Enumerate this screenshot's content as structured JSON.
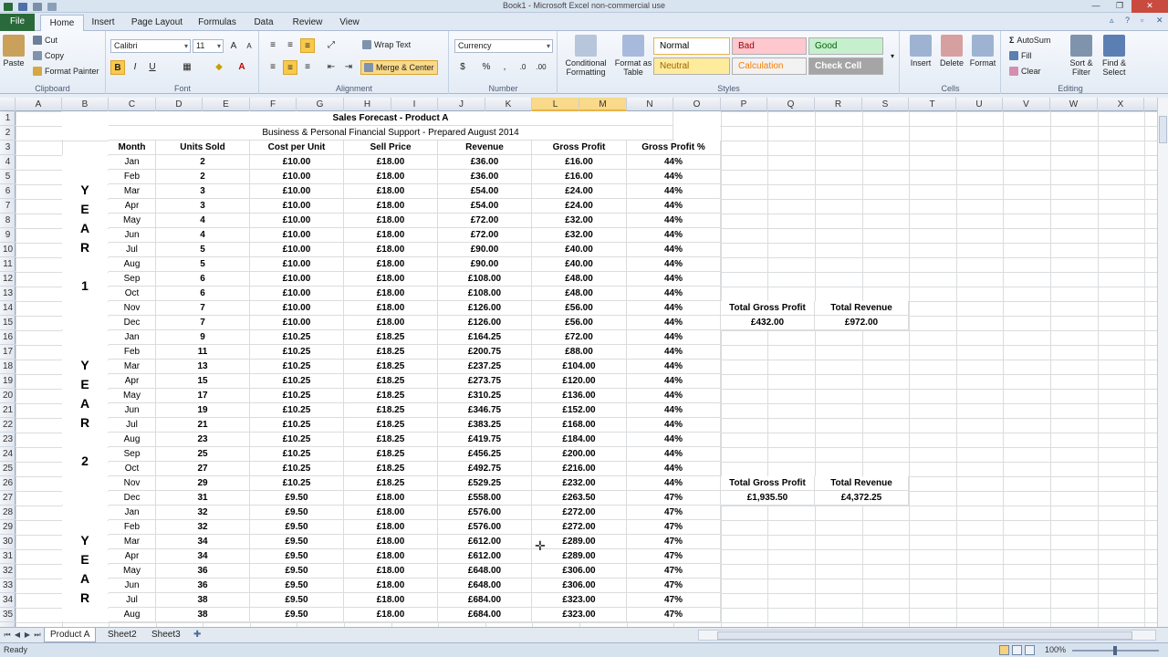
{
  "window": {
    "title": "Book1 - Microsoft Excel non-commercial use",
    "controls": [
      "—",
      "❐",
      "✕"
    ]
  },
  "ribbon_tabs": [
    "File",
    "Home",
    "Insert",
    "Page Layout",
    "Formulas",
    "Data",
    "Review",
    "View"
  ],
  "ribbon": {
    "clipboard": {
      "paste": "Paste",
      "cut": "Cut",
      "copy": "Copy",
      "format_painter": "Format Painter",
      "label": "Clipboard"
    },
    "font": {
      "name": "Calibri",
      "size": "11",
      "bold": "B",
      "italic": "I",
      "underline": "U",
      "label": "Font"
    },
    "alignment": {
      "wrap_text": "Wrap Text",
      "merge_center": "Merge & Center",
      "label": "Alignment"
    },
    "number": {
      "format": "Currency",
      "percent": "%",
      "comma": ",",
      "label": "Number"
    },
    "styles": {
      "conditional_formatting": "Conditional Formatting",
      "format_as_table": "Format as Table",
      "normal": "Normal",
      "bad": "Bad",
      "good": "Good",
      "neutral": "Neutral",
      "calculation": "Calculation",
      "check_cell": "Check Cell",
      "label": "Styles"
    },
    "cells": {
      "insert": "Insert",
      "delete": "Delete",
      "format": "Format",
      "label": "Cells"
    },
    "editing": {
      "autosum": "AutoSum",
      "fill": "Fill",
      "clear": "Clear",
      "sort_filter": "Sort & Filter",
      "find_select": "Find & Select",
      "label": "Editing"
    }
  },
  "columns": [
    "A",
    "B",
    "C",
    "D",
    "E",
    "F",
    "G",
    "H",
    "I",
    "J",
    "K",
    "L",
    "M",
    "N",
    "O",
    "P",
    "Q",
    "R",
    "S",
    "T",
    "U",
    "V",
    "W",
    "X"
  ],
  "selected_column": [
    "L",
    "M"
  ],
  "rows": [
    "1",
    "2",
    "3",
    "4",
    "5",
    "6",
    "7",
    "8",
    "9",
    "10",
    "11",
    "12",
    "13",
    "14",
    "15",
    "16",
    "17",
    "18",
    "19",
    "20",
    "21",
    "22",
    "23",
    "24",
    "25",
    "26",
    "27",
    "28",
    "29",
    "30",
    "31",
    "32",
    "33",
    "34",
    "35"
  ],
  "sheet": {
    "title": "Sales Forecast - Product A",
    "subtitle": "Business & Personal Financial Support - Prepared August 2014",
    "headers": [
      "Month",
      "Units Sold",
      "Cost per Unit",
      "Sell Price",
      "Revenue",
      "Gross Profit",
      "Gross Profit %"
    ],
    "year_labels": [
      [
        "Y",
        "E",
        "A",
        "R",
        "",
        "1"
      ],
      [
        "Y",
        "E",
        "A",
        "R",
        "",
        "2"
      ],
      [
        "Y",
        "E",
        "A",
        "R"
      ]
    ],
    "data": [
      [
        "Jan",
        "2",
        "£10.00",
        "£18.00",
        "£36.00",
        "£16.00",
        "44%"
      ],
      [
        "Feb",
        "2",
        "£10.00",
        "£18.00",
        "£36.00",
        "£16.00",
        "44%"
      ],
      [
        "Mar",
        "3",
        "£10.00",
        "£18.00",
        "£54.00",
        "£24.00",
        "44%"
      ],
      [
        "Apr",
        "3",
        "£10.00",
        "£18.00",
        "£54.00",
        "£24.00",
        "44%"
      ],
      [
        "May",
        "4",
        "£10.00",
        "£18.00",
        "£72.00",
        "£32.00",
        "44%"
      ],
      [
        "Jun",
        "4",
        "£10.00",
        "£18.00",
        "£72.00",
        "£32.00",
        "44%"
      ],
      [
        "Jul",
        "5",
        "£10.00",
        "£18.00",
        "£90.00",
        "£40.00",
        "44%"
      ],
      [
        "Aug",
        "5",
        "£10.00",
        "£18.00",
        "£90.00",
        "£40.00",
        "44%"
      ],
      [
        "Sep",
        "6",
        "£10.00",
        "£18.00",
        "£108.00",
        "£48.00",
        "44%"
      ],
      [
        "Oct",
        "6",
        "£10.00",
        "£18.00",
        "£108.00",
        "£48.00",
        "44%"
      ],
      [
        "Nov",
        "7",
        "£10.00",
        "£18.00",
        "£126.00",
        "£56.00",
        "44%"
      ],
      [
        "Dec",
        "7",
        "£10.00",
        "£18.00",
        "£126.00",
        "£56.00",
        "44%"
      ],
      [
        "Jan",
        "9",
        "£10.25",
        "£18.25",
        "£164.25",
        "£72.00",
        "44%"
      ],
      [
        "Feb",
        "11",
        "£10.25",
        "£18.25",
        "£200.75",
        "£88.00",
        "44%"
      ],
      [
        "Mar",
        "13",
        "£10.25",
        "£18.25",
        "£237.25",
        "£104.00",
        "44%"
      ],
      [
        "Apr",
        "15",
        "£10.25",
        "£18.25",
        "£273.75",
        "£120.00",
        "44%"
      ],
      [
        "May",
        "17",
        "£10.25",
        "£18.25",
        "£310.25",
        "£136.00",
        "44%"
      ],
      [
        "Jun",
        "19",
        "£10.25",
        "£18.25",
        "£346.75",
        "£152.00",
        "44%"
      ],
      [
        "Jul",
        "21",
        "£10.25",
        "£18.25",
        "£383.25",
        "£168.00",
        "44%"
      ],
      [
        "Aug",
        "23",
        "£10.25",
        "£18.25",
        "£419.75",
        "£184.00",
        "44%"
      ],
      [
        "Sep",
        "25",
        "£10.25",
        "£18.25",
        "£456.25",
        "£200.00",
        "44%"
      ],
      [
        "Oct",
        "27",
        "£10.25",
        "£18.25",
        "£492.75",
        "£216.00",
        "44%"
      ],
      [
        "Nov",
        "29",
        "£10.25",
        "£18.25",
        "£529.25",
        "£232.00",
        "44%"
      ],
      [
        "Dec",
        "31",
        "£9.50",
        "£18.00",
        "£558.00",
        "£263.50",
        "47%"
      ],
      [
        "Jan",
        "32",
        "£9.50",
        "£18.00",
        "£576.00",
        "£272.00",
        "47%"
      ],
      [
        "Feb",
        "32",
        "£9.50",
        "£18.00",
        "£576.00",
        "£272.00",
        "47%"
      ],
      [
        "Mar",
        "34",
        "£9.50",
        "£18.00",
        "£612.00",
        "£289.00",
        "47%"
      ],
      [
        "Apr",
        "34",
        "£9.50",
        "£18.00",
        "£612.00",
        "£289.00",
        "47%"
      ],
      [
        "May",
        "36",
        "£9.50",
        "£18.00",
        "£648.00",
        "£306.00",
        "47%"
      ],
      [
        "Jun",
        "36",
        "£9.50",
        "£18.00",
        "£648.00",
        "£306.00",
        "47%"
      ],
      [
        "Jul",
        "38",
        "£9.50",
        "£18.00",
        "£684.00",
        "£323.00",
        "47%"
      ],
      [
        "Aug",
        "38",
        "£9.50",
        "£18.00",
        "£684.00",
        "£323.00",
        "47%"
      ]
    ],
    "summary_year1": {
      "gp_label": "Total Gross Profit",
      "rev_label": "Total Revenue",
      "gp_value": "£432.00",
      "rev_value": "£972.00"
    },
    "summary_year2": {
      "gp_label": "Total Gross Profit",
      "rev_label": "Total Revenue",
      "gp_value": "£1,935.50",
      "rev_value": "£4,372.25"
    }
  },
  "sheet_tabs": [
    "Product A",
    "Sheet2",
    "Sheet3"
  ],
  "status": {
    "ready": "Ready",
    "zoom": "100%"
  },
  "colors": {
    "file_tab": "#2a6a3a",
    "selection": "#f9d98a",
    "bad": "#ffc7ce",
    "good": "#c6efce",
    "neutral": "#ffeb9c",
    "check_cell": "#a5a5a5"
  }
}
